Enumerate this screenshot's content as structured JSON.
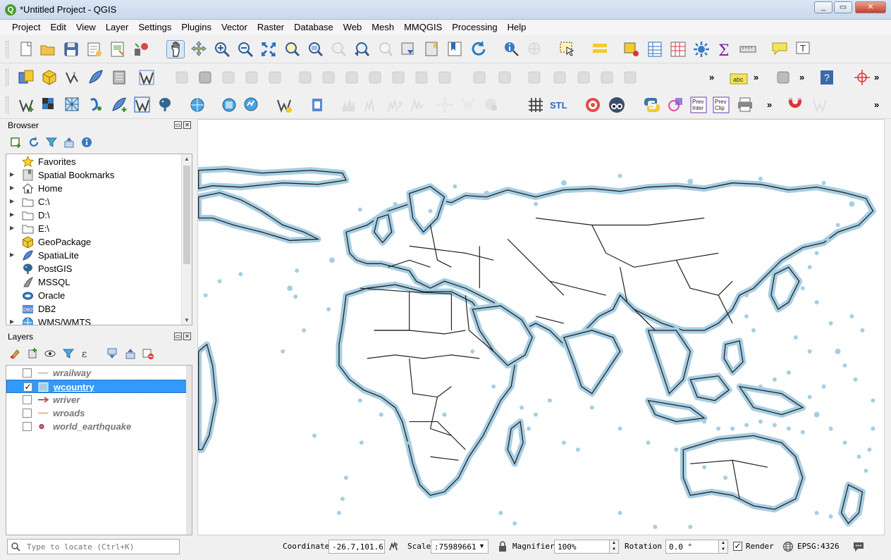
{
  "window": {
    "title": "*Untitled Project - QGIS",
    "app_icon": "Q",
    "controls": [
      "minimize",
      "maximize",
      "close"
    ]
  },
  "menu": [
    "Project",
    "Edit",
    "View",
    "Layer",
    "Settings",
    "Plugins",
    "Vector",
    "Raster",
    "Database",
    "Web",
    "Mesh",
    "MMQGIS",
    "Processing",
    "Help"
  ],
  "toolbars": {
    "row1_icons": [
      "new-project-icon",
      "open-project-icon",
      "save-project-icon",
      "save-as-icon",
      "print-layout-icon",
      "style-manager-icon",
      "pan-icon",
      "pan-to-selection-icon",
      "zoom-in-icon",
      "zoom-out-icon",
      "zoom-full-icon",
      "zoom-to-selection-icon",
      "zoom-to-layer-icon",
      "zoom-native-icon",
      "zoom-last-icon",
      "zoom-next-icon",
      "new-bookmark-icon",
      "show-bookmarks-icon",
      "spatial-bookmark-icon",
      "refresh-icon",
      "identify-icon",
      "measure-icon",
      "select-feature-icon",
      "attribute-table-icon",
      "deselect-icon",
      "open-table-icon",
      "field-calculator-icon",
      "toolbox-icon",
      "statistics-icon",
      "measure-line-icon",
      "map-tips-icon",
      "text-annotation-icon"
    ],
    "row2_icons": [
      "data-source-manager-icon",
      "new-geopackage-icon",
      "new-shapefile-icon",
      "new-spatialite-icon",
      "new-temporary-layer-icon",
      "new-virtual-layer-icon",
      "current-edits-icon",
      "toggle-editing-icon",
      "save-edits-icon",
      "add-feature-icon",
      "vertex-tool-icon",
      "modify-attributes-icon",
      "delete-selected-icon",
      "cut-features-icon",
      "copy-features-icon",
      "paste-features-icon",
      "undo-icon",
      "redo-icon",
      "digitize-icon",
      "add-ring-icon",
      "fill-ring-icon",
      "add-part-icon",
      "delete-ring-icon",
      "delete-part-icon",
      "reshape-icon",
      "label-icon",
      "geometry-checker-icon",
      "help-icon",
      "crosshair-icon"
    ],
    "row3_icons": [
      "add-vector-layer-icon",
      "add-raster-layer-icon",
      "add-mesh-layer-icon",
      "add-delimited-text-icon",
      "add-spatialite-layer-icon",
      "add-virtual-layer-icon",
      "add-postgis-layer-icon",
      "add-wms-layer-icon",
      "add-wcs-layer-icon",
      "add-wfs-layer-icon",
      "add-arcgis-layer-icon",
      "new-geopackage-layer-icon",
      "profile-tool-icon",
      "align-rasters-icon",
      "raster-calculator-icon",
      "georeferencer-icon",
      "sun-icon",
      "shade-icon",
      "globe-icon",
      "grid-icon",
      "stl-icon",
      "target-icon",
      "binoculars-icon",
      "python-console-icon",
      "eraser-icon",
      "prev-inter-icon",
      "prev-clip-icon",
      "printer-icon",
      "magnet-icon",
      "vertex-editor-icon"
    ],
    "prev_inter": "Prev\nInter",
    "prev_clip": "Prev\nClip",
    "stl_label": "STL",
    "abc_label": "abc",
    "more": "»"
  },
  "browser_panel": {
    "title": "Browser",
    "items": [
      {
        "label": "Favorites",
        "icon": "star-icon",
        "expandable": false
      },
      {
        "label": "Spatial Bookmarks",
        "icon": "bookmark-icon",
        "expandable": true
      },
      {
        "label": "Home",
        "icon": "home-icon",
        "expandable": true
      },
      {
        "label": "C:\\",
        "icon": "folder-icon",
        "expandable": true
      },
      {
        "label": "D:\\",
        "icon": "folder-icon",
        "expandable": true
      },
      {
        "label": "E:\\",
        "icon": "folder-icon",
        "expandable": true
      },
      {
        "label": "GeoPackage",
        "icon": "geopackage-icon",
        "expandable": false
      },
      {
        "label": "SpatiaLite",
        "icon": "spatialite-icon",
        "expandable": true
      },
      {
        "label": "PostGIS",
        "icon": "postgis-icon",
        "expandable": false
      },
      {
        "label": "MSSQL",
        "icon": "mssql-icon",
        "expandable": false
      },
      {
        "label": "Oracle",
        "icon": "oracle-icon",
        "expandable": false
      },
      {
        "label": "DB2",
        "icon": "db2-icon",
        "expandable": false
      },
      {
        "label": "WMS/WMTS",
        "icon": "wms-icon",
        "expandable": true
      }
    ]
  },
  "layers_panel": {
    "title": "Layers",
    "layers": [
      {
        "name": "wrailway",
        "checked": false,
        "selected": false,
        "symbol": "line-gray"
      },
      {
        "name": "wcountry",
        "checked": true,
        "selected": true,
        "symbol": "polygon-lightblue"
      },
      {
        "name": "wriver",
        "checked": false,
        "selected": false,
        "symbol": "arrow-red"
      },
      {
        "name": "wroads",
        "checked": false,
        "selected": false,
        "symbol": "line-orange"
      },
      {
        "name": "world_earthquake",
        "checked": false,
        "selected": false,
        "symbol": "point-pink"
      }
    ]
  },
  "map": {
    "fill_color": "#a6cee3",
    "stroke_color": "#231f20",
    "background": "#ffffff"
  },
  "status": {
    "locator_placeholder": "Type to locate (Ctrl+K)",
    "coordinate_label": "Coordinate",
    "coordinate_value": "-26.7,101.6",
    "scale_label": "Scale",
    "scale_value": ":75989661",
    "magnifier_label": "Magnifier",
    "magnifier_value": "100%",
    "rotation_label": "Rotation",
    "rotation_value": "0.0 °",
    "render_label": "Render",
    "render_checked": true,
    "crs_label": "EPSG:4326"
  }
}
